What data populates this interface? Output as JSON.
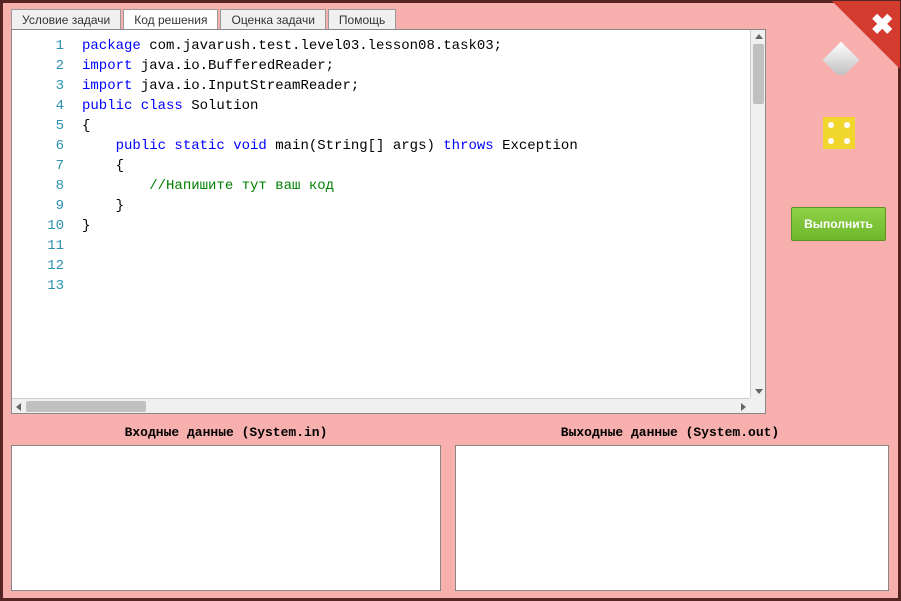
{
  "tabs": {
    "condition": "Условие задачи",
    "code": "Код решения",
    "grade": "Оценка задачи",
    "help": "Помощь"
  },
  "editor": {
    "lines": [
      {
        "n": "1",
        "kw": "package",
        "rest": " com.javarush.test.level03.lesson08.task03;"
      },
      {
        "n": "2",
        "rest": ""
      },
      {
        "n": "3",
        "kw": "import",
        "rest": " java.io.BufferedReader;"
      },
      {
        "n": "4",
        "kw": "import",
        "rest": " java.io.InputStreamReader;"
      },
      {
        "n": "5",
        "rest": ""
      },
      {
        "n": "6",
        "kw": "public class",
        "rest": " Solution"
      },
      {
        "n": "7",
        "rest": "{"
      },
      {
        "n": "8",
        "prefix": "    ",
        "kw": "public static void",
        "mid": " main(String[] args) ",
        "kw2": "throws",
        "rest": " Exception"
      },
      {
        "n": "9",
        "rest": "    {"
      },
      {
        "n": "10",
        "prefix": "        ",
        "cm": "//Напишите тут ваш код"
      },
      {
        "n": "11",
        "rest": "    }"
      },
      {
        "n": "12",
        "rest": "}"
      },
      {
        "n": "13",
        "rest": ""
      }
    ]
  },
  "io": {
    "input_label": "Входные данные (System.in)",
    "output_label": "Выходные данные (System.out)",
    "input_value": "",
    "output_value": ""
  },
  "buttons": {
    "run": "Выполнить"
  }
}
